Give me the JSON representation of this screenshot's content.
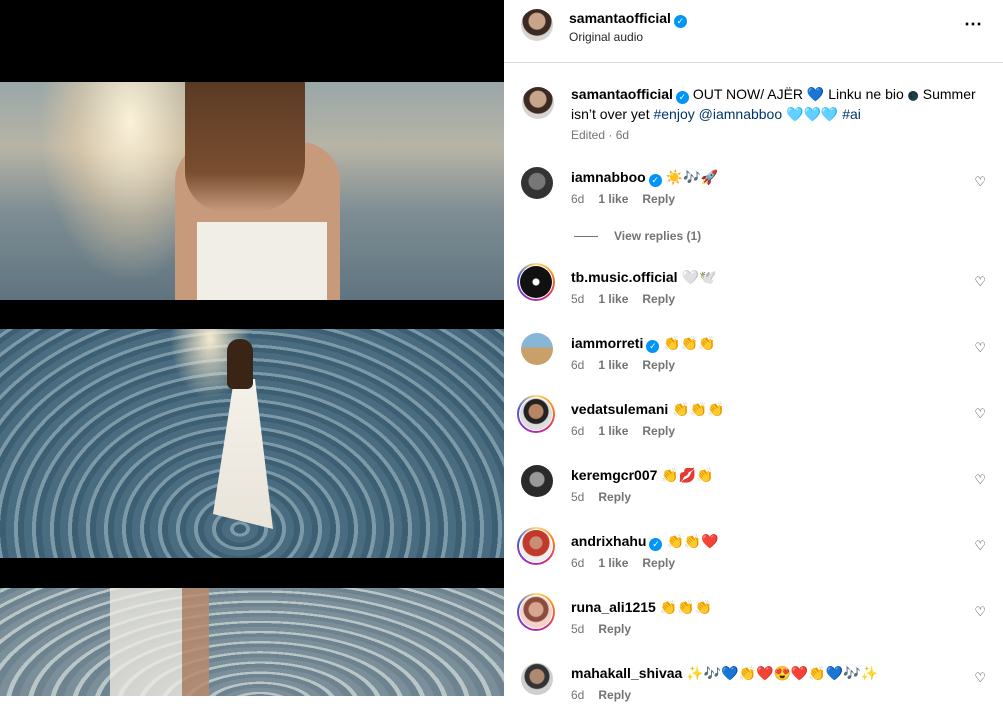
{
  "post": {
    "author": "samantaofficial",
    "audio": "Original audio",
    "more_icon": "…"
  },
  "caption": {
    "username": "samantaofficial",
    "text_1": "OUT NOW/ AJËR",
    "emoji_1": "💙",
    "text_2": "Linku ne bio",
    "emoji_2": "🌑",
    "text_3": "Summer isn’t over yet",
    "hashtag_1": "#enjoy",
    "mention": "@iamnabboo",
    "emoji_3": "🩵🩵🩵",
    "hashtag_2": "#ai",
    "meta": "Edited · 6d"
  },
  "comments": [
    {
      "username": "iamnabboo",
      "verified": true,
      "text": "☀️🎶🚀",
      "time": "6d",
      "likes": "1 like",
      "reply": "Reply",
      "story_ring": false
    },
    {
      "username": "tb.music.official",
      "verified": false,
      "text": "🤍🕊️",
      "time": "5d",
      "likes": "1 like",
      "reply": "Reply",
      "story_ring": true
    },
    {
      "username": "iammorreti",
      "verified": true,
      "text": "👏👏👏",
      "time": "6d",
      "likes": "1 like",
      "reply": "Reply",
      "story_ring": false
    },
    {
      "username": "vedatsulemani",
      "verified": false,
      "text": "👏👏👏",
      "time": "6d",
      "likes": "1 like",
      "reply": "Reply",
      "story_ring": true
    },
    {
      "username": "keremgcr007",
      "verified": false,
      "text": "👏💋👏",
      "time": "5d",
      "likes": "",
      "reply": "Reply",
      "story_ring": false
    },
    {
      "username": "andrixhahu",
      "verified": true,
      "text": "👏👏❤️",
      "time": "6d",
      "likes": "1 like",
      "reply": "Reply",
      "story_ring": true
    },
    {
      "username": "runa_ali1215",
      "verified": false,
      "text": "👏👏👏",
      "time": "5d",
      "likes": "",
      "reply": "Reply",
      "story_ring": true
    },
    {
      "username": "mahakall_shivaa",
      "verified": false,
      "text": "✨🎶💙👏❤️😍❤️👏💙🎶✨",
      "time": "6d",
      "likes": "",
      "reply": "Reply",
      "story_ring": false
    }
  ],
  "view_replies": "View replies (1)",
  "icons": {
    "heart": "heart-outline-icon",
    "verified": "verified-badge-icon",
    "more": "more-options-icon"
  },
  "colors": {
    "verified": "#0095f6",
    "link": "#00376b",
    "meta": "#737373"
  }
}
